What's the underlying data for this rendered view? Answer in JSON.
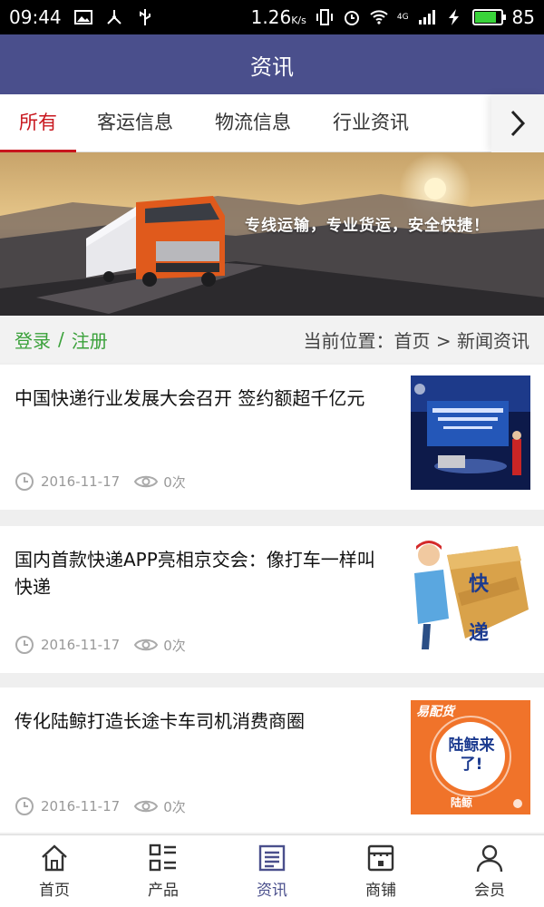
{
  "status_bar": {
    "time": "09:44",
    "speed": "1.26",
    "speed_unit": "K/s",
    "network": "4G",
    "battery_pct": "85",
    "battery_level": 0.85
  },
  "header": {
    "title": "资讯"
  },
  "tabs": [
    {
      "label": "所有",
      "active": true
    },
    {
      "label": "客运信息",
      "active": false
    },
    {
      "label": "物流信息",
      "active": false
    },
    {
      "label": "行业资讯",
      "active": false
    }
  ],
  "banner": {
    "slogan": "专线运输，专业货运，安全快捷！"
  },
  "login_bar": {
    "login": "登录",
    "separator": "/",
    "register": "注册",
    "location_label": "当前位置：",
    "crumb_home": "首页",
    "crumb_sep": ">",
    "crumb_current": "新闻资讯"
  },
  "news": [
    {
      "title": "中国快递行业发展大会召开 签约额超千亿元",
      "date": "2016-11-17",
      "views": "0次",
      "thumb": "conference-photo"
    },
    {
      "title": "国内首款快递APP亮相京交会：像打车一样叫快递",
      "date": "2016-11-17",
      "views": "0次",
      "thumb": "courier-box-illustration",
      "thumb_text": "快递"
    },
    {
      "title": "传化陆鲸打造长途卡车司机消费商圈",
      "date": "2016-11-17",
      "views": "0次",
      "thumb": "lujing-poster",
      "thumb_top": "易配货",
      "thumb_main": "陆鲸来了!",
      "thumb_bottom": "陆鲸"
    }
  ],
  "bottom_nav": [
    {
      "label": "首页",
      "icon": "home-icon",
      "active": false
    },
    {
      "label": "产品",
      "icon": "grid-list-icon",
      "active": false
    },
    {
      "label": "资讯",
      "icon": "news-icon",
      "active": true
    },
    {
      "label": "商铺",
      "icon": "store-icon",
      "active": false
    },
    {
      "label": "会员",
      "icon": "user-icon",
      "active": false
    }
  ],
  "colors": {
    "header": "#4a4f8c",
    "accent": "#c8161d",
    "login": "#3aa13a"
  }
}
